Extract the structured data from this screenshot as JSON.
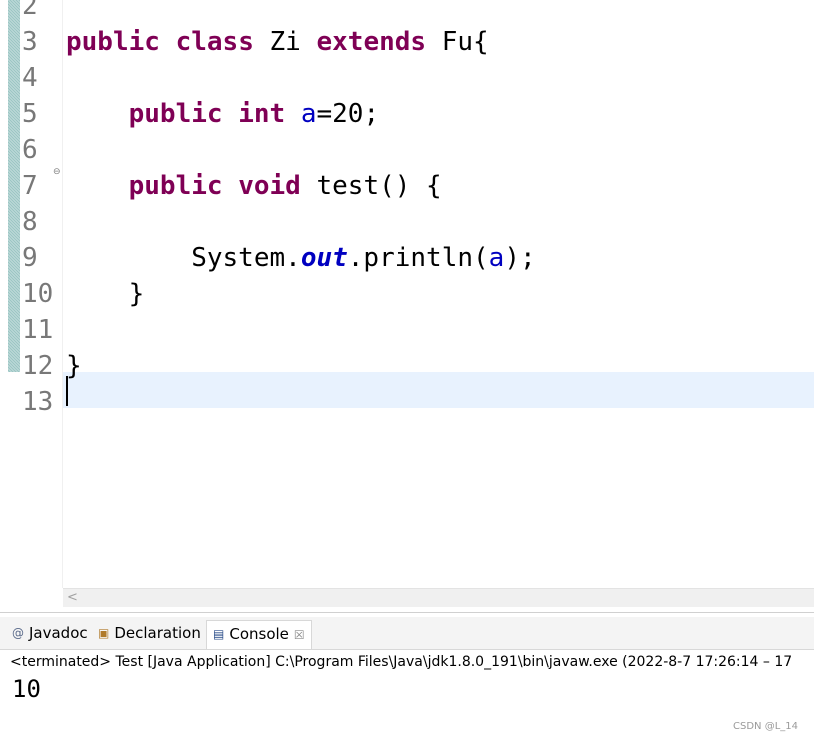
{
  "editor": {
    "lines": [
      {
        "num": "2",
        "code": ""
      },
      {
        "num": "3",
        "tokens": [
          [
            "kw",
            "public"
          ],
          [
            "t",
            " "
          ],
          [
            "kw",
            "class"
          ],
          [
            "t",
            " Zi "
          ],
          [
            "kw",
            "extends"
          ],
          [
            "t",
            " Fu{"
          ]
        ]
      },
      {
        "num": "4",
        "code": ""
      },
      {
        "num": "5",
        "tokens": [
          [
            "t",
            "    "
          ],
          [
            "kw",
            "public"
          ],
          [
            "t",
            " "
          ],
          [
            "kw",
            "int"
          ],
          [
            "t",
            " "
          ],
          [
            "field",
            "a"
          ],
          [
            "t",
            "=20;"
          ]
        ]
      },
      {
        "num": "6",
        "code": ""
      },
      {
        "num": "7",
        "tokens": [
          [
            "t",
            "    "
          ],
          [
            "kw",
            "public"
          ],
          [
            "t",
            " "
          ],
          [
            "kw",
            "void"
          ],
          [
            "t",
            " test() {"
          ]
        ]
      },
      {
        "num": "8",
        "code": ""
      },
      {
        "num": "9",
        "tokens": [
          [
            "t",
            "        System."
          ],
          [
            "static",
            "out"
          ],
          [
            "t",
            ".println("
          ],
          [
            "field",
            "a"
          ],
          [
            "t",
            ");"
          ]
        ]
      },
      {
        "num": "10",
        "tokens": [
          [
            "t",
            "    }"
          ]
        ]
      },
      {
        "num": "11",
        "code": ""
      },
      {
        "num": "12",
        "tokens": [
          [
            "t",
            "}"
          ]
        ]
      },
      {
        "num": "13",
        "code": ""
      }
    ],
    "fold_marker": "⊖",
    "scroll_left": "<"
  },
  "panel": {
    "tabs": [
      {
        "id": "javadoc",
        "icon": "@",
        "label": "Javadoc"
      },
      {
        "id": "declaration",
        "icon": "▣",
        "label": "Declaration"
      },
      {
        "id": "console",
        "icon": "▤",
        "label": "Console",
        "close": "☒"
      }
    ],
    "status": "<terminated> Test [Java Application] C:\\Program Files\\Java\\jdk1.8.0_191\\bin\\javaw.exe  (2022-8-7 17:26:14 – 17",
    "output": "10"
  },
  "watermark": "CSDN @L_14",
  "colors": {
    "keyword": "#7f0055",
    "field": "#0000c0",
    "current_line": "#e8f2fe"
  }
}
